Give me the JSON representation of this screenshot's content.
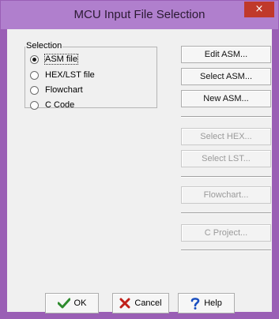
{
  "window": {
    "title": "MCU Input File Selection",
    "close_glyph": "×"
  },
  "selection": {
    "legend": "Selection",
    "options": [
      {
        "label": "ASM file",
        "checked": true
      },
      {
        "label": "HEX/LST file",
        "checked": false
      },
      {
        "label": "Flowchart",
        "checked": false
      },
      {
        "label": "C Code",
        "checked": false
      }
    ]
  },
  "buttons": {
    "edit_asm": "Edit ASM...",
    "select_asm": "Select ASM...",
    "new_asm": "New ASM...",
    "select_hex": "Select HEX...",
    "select_lst": "Select LST...",
    "flowchart": "Flowchart...",
    "c_project": "C Project..."
  },
  "footer": {
    "ok": "OK",
    "cancel": "Cancel",
    "help": "Help"
  },
  "colors": {
    "titlebar": "#b07fcd",
    "close": "#c0392b",
    "ok_icon": "#2e8b2e",
    "cancel_icon": "#c0201a",
    "help_icon": "#1a4fc0"
  },
  "icons": {
    "ok": "checkmark-icon",
    "cancel": "x-icon",
    "help": "question-mark-icon",
    "close": "close-icon"
  }
}
